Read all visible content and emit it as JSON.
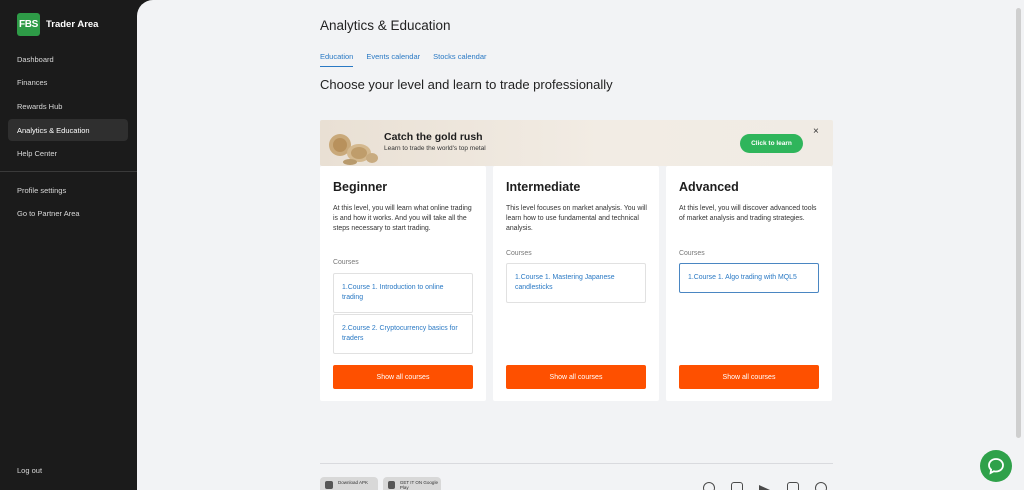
{
  "app": {
    "logo_text": "FBS",
    "title": "Trader Area"
  },
  "sidebar": {
    "items": [
      {
        "label": "Dashboard"
      },
      {
        "label": "Finances"
      },
      {
        "label": "Rewards Hub"
      },
      {
        "label": "Analytics & Education",
        "active": true
      },
      {
        "label": "Help Center"
      },
      {
        "label": "Profile settings"
      },
      {
        "label": "Go to Partner Area"
      }
    ],
    "logout": "Log out"
  },
  "page": {
    "title": "Analytics & Education",
    "tabs": [
      {
        "label": "Education",
        "active": true
      },
      {
        "label": "Events calendar"
      },
      {
        "label": "Stocks calendar"
      }
    ],
    "headline": "Choose your level and learn to trade professionally"
  },
  "banner": {
    "title": "Catch the gold rush",
    "subtitle": "Learn to trade the world's top metal",
    "button": "Click to learn",
    "close": "×"
  },
  "levels": [
    {
      "title": "Beginner",
      "description": "At this level, you will learn what online trading is and how it works. And you will take all the steps necessary to start trading.",
      "courses_label": "Courses",
      "courses": [
        "1.Course 1. Introduction to online trading",
        "2.Course 2. Cryptocurrency basics for traders"
      ],
      "button": "Show all courses"
    },
    {
      "title": "Intermediate",
      "description": "This level focuses on market analysis. You will learn how to use fundamental and technical analysis.",
      "courses_label": "Courses",
      "courses": [
        "1.Course 1. Mastering Japanese candlesticks"
      ],
      "button": "Show all courses"
    },
    {
      "title": "Advanced",
      "description": "At this level, you will discover advanced tools of market analysis and trading strategies.",
      "courses_label": "Courses",
      "courses": [
        "1.Course 1. Algo trading with MQL5"
      ],
      "button": "Show all courses"
    }
  ],
  "footer": {
    "badges": [
      "Download APK",
      "GET IT ON Google Play"
    ],
    "social_icons": [
      "messenger-icon",
      "line-icon",
      "telegram-icon",
      "chat-bubble-icon",
      "whatsapp-icon"
    ]
  },
  "colors": {
    "accent": "#fe5000",
    "link": "#2a79c4",
    "brand_green": "#2e9b47",
    "sidebar_bg": "#1b1b1b",
    "page_bg": "#f2f3f5"
  }
}
